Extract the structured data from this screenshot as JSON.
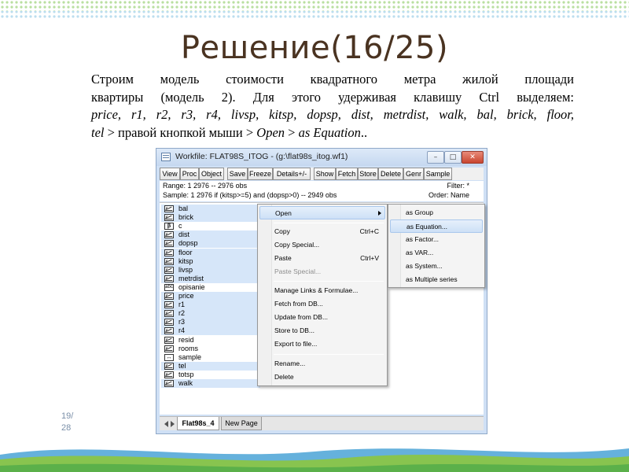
{
  "slide": {
    "title": "Решение(16/25)",
    "paragraph": {
      "line1": "Строим модель стоимости квадратного метра жилой площади",
      "line2": "квартиры (модель 2). Для этого удерживая клавишу Ctrl выделяем:",
      "line3": "price, r1, r2, r3, r4, livsp, kitsp, dopsp, dist, metrdist, walk,  bal, brick, floor,",
      "line4_italic_a": "tel",
      "line4_a": " > правой кнопкой мыши > ",
      "line4_italic_b": "Open",
      "line4_b": " > ",
      "line4_italic_c": "as Equation",
      "line4_c": ".."
    },
    "page_number": {
      "current": "19/",
      "total": "28"
    },
    "colors": {
      "title": "#4a3321",
      "accent_green": "#8cc63f",
      "accent_blue": "#4a90c8"
    }
  },
  "window": {
    "title": "Workfile: FLAT98S_ITOG - (g:\\flat98s_itog.wf1)",
    "controls": {
      "minimize": "–",
      "maximize": "□",
      "close": "✕"
    },
    "toolbar": [
      "View",
      "Proc",
      "Object",
      "Save",
      "Freeze",
      "Details+/-",
      "Show",
      "Fetch",
      "Store",
      "Delete",
      "Genr",
      "Sample"
    ],
    "range_label": "Range:  1 2976  --  2976 obs",
    "filter_label": "Filter: *",
    "sample_label": "Sample: 1 2976 if (kitsp>=5) and (dopsp>0)  --  2949 obs",
    "order_label": "Order: Name",
    "objects": [
      {
        "name": "bal",
        "icon": "series-icon",
        "selected": true
      },
      {
        "name": "brick",
        "icon": "series-icon",
        "selected": true
      },
      {
        "name": "c",
        "icon": "coef-icon",
        "selected": false
      },
      {
        "name": "dist",
        "icon": "series-icon",
        "selected": true
      },
      {
        "name": "dopsp",
        "icon": "series-icon",
        "selected": true
      },
      {
        "name": "floor",
        "icon": "series-icon",
        "selected": true
      },
      {
        "name": "kitsp",
        "icon": "series-icon",
        "selected": true
      },
      {
        "name": "livsp",
        "icon": "series-icon",
        "selected": true
      },
      {
        "name": "metrdist",
        "icon": "series-icon",
        "selected": true
      },
      {
        "name": "opisanie",
        "icon": "alpha-icon",
        "selected": false
      },
      {
        "name": "price",
        "icon": "series-icon",
        "selected": true
      },
      {
        "name": "r1",
        "icon": "series-icon",
        "selected": true
      },
      {
        "name": "r2",
        "icon": "series-icon",
        "selected": true
      },
      {
        "name": "r3",
        "icon": "series-icon",
        "selected": true
      },
      {
        "name": "r4",
        "icon": "series-icon",
        "selected": true
      },
      {
        "name": "resid",
        "icon": "series-icon",
        "selected": false
      },
      {
        "name": "rooms",
        "icon": "series-icon",
        "selected": false
      },
      {
        "name": "sample",
        "icon": "sample-icon",
        "selected": false
      },
      {
        "name": "tel",
        "icon": "series-icon",
        "selected": true
      },
      {
        "name": "totsp",
        "icon": "series-icon",
        "selected": false
      },
      {
        "name": "walk",
        "icon": "series-icon",
        "selected": true
      }
    ],
    "tabs": {
      "active": "Flat98s_4",
      "other": "New Page"
    }
  },
  "context_menu": {
    "items": [
      {
        "label": "Open",
        "shortcut": "",
        "submenu": true,
        "disabled": false,
        "highlighted": true
      },
      {
        "label": "Copy",
        "shortcut": "Ctrl+C",
        "disabled": false
      },
      {
        "label": "Copy Special...",
        "shortcut": "",
        "disabled": false
      },
      {
        "label": "Paste",
        "shortcut": "Ctrl+V",
        "disabled": false
      },
      {
        "label": "Paste Special...",
        "shortcut": "",
        "disabled": true
      },
      {
        "label": "Manage Links & Formulae...",
        "shortcut": "",
        "disabled": false
      },
      {
        "label": "Fetch from DB...",
        "shortcut": "",
        "disabled": false
      },
      {
        "label": "Update from DB...",
        "shortcut": "",
        "disabled": false
      },
      {
        "label": "Store to DB...",
        "shortcut": "",
        "disabled": false
      },
      {
        "label": "Export to file...",
        "shortcut": "",
        "disabled": false
      },
      {
        "label": "Rename...",
        "shortcut": "",
        "disabled": false
      },
      {
        "label": "Delete",
        "shortcut": "",
        "disabled": false
      }
    ],
    "submenu": [
      {
        "label": "as Group",
        "highlighted": false
      },
      {
        "label": "as Equation...",
        "highlighted": true
      },
      {
        "label": "as Factor...",
        "highlighted": false
      },
      {
        "label": "as VAR...",
        "highlighted": false
      },
      {
        "label": "as System...",
        "highlighted": false
      },
      {
        "label": "as Multiple series",
        "highlighted": false
      }
    ]
  }
}
